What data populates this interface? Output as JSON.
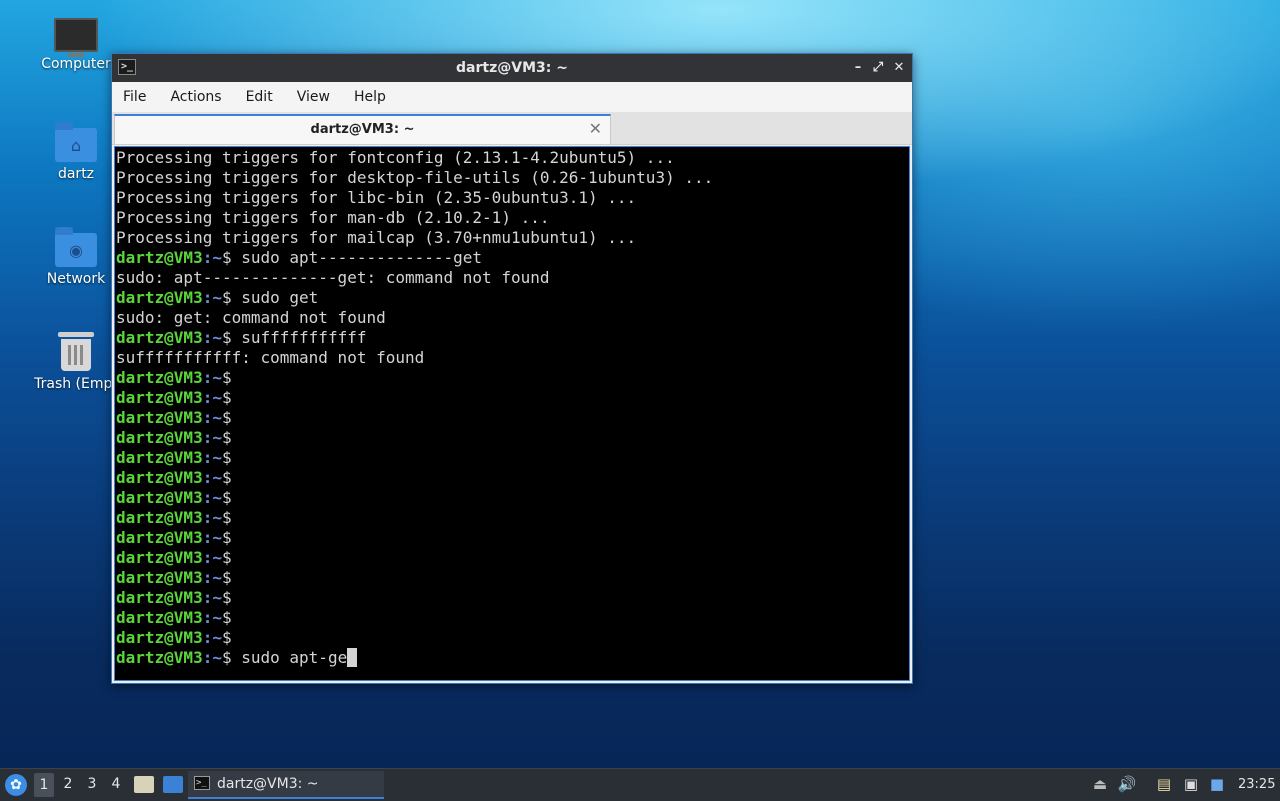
{
  "desktop": {
    "icons": [
      {
        "label": "Computer"
      },
      {
        "label": "dartz"
      },
      {
        "label": "Network"
      },
      {
        "label": "Trash (Empt"
      }
    ]
  },
  "window": {
    "title": "dartz@VM3: ~",
    "controls": {
      "minimize": "–",
      "maximize": "⤢",
      "close": "✕"
    },
    "menu": [
      "File",
      "Actions",
      "Edit",
      "View",
      "Help"
    ],
    "tab": {
      "title": "dartz@VM3: ~",
      "close": "✕"
    }
  },
  "terminal": {
    "prompt_user": "dartz@VM3",
    "prompt_path": ":~",
    "prompt_symbol": "$",
    "lines": [
      {
        "type": "out",
        "text": "Processing triggers for fontconfig (2.13.1-4.2ubuntu5) ..."
      },
      {
        "type": "out",
        "text": "Processing triggers for desktop-file-utils (0.26-1ubuntu3) ..."
      },
      {
        "type": "out",
        "text": "Processing triggers for libc-bin (2.35-0ubuntu3.1) ..."
      },
      {
        "type": "out",
        "text": "Processing triggers for man-db (2.10.2-1) ..."
      },
      {
        "type": "out",
        "text": "Processing triggers for mailcap (3.70+nmu1ubuntu1) ..."
      },
      {
        "type": "cmd",
        "text": " sudo apt--------------get"
      },
      {
        "type": "out",
        "text": "sudo: apt--------------get: command not found"
      },
      {
        "type": "cmd",
        "text": " sudo get"
      },
      {
        "type": "out",
        "text": "sudo: get: command not found"
      },
      {
        "type": "cmd",
        "text": " sufffffffffff"
      },
      {
        "type": "out",
        "text": "sufffffffffff: command not found"
      },
      {
        "type": "cmd",
        "text": ""
      },
      {
        "type": "cmd",
        "text": ""
      },
      {
        "type": "cmd",
        "text": ""
      },
      {
        "type": "cmd",
        "text": ""
      },
      {
        "type": "cmd",
        "text": ""
      },
      {
        "type": "cmd",
        "text": ""
      },
      {
        "type": "cmd",
        "text": ""
      },
      {
        "type": "cmd",
        "text": ""
      },
      {
        "type": "cmd",
        "text": ""
      },
      {
        "type": "cmd",
        "text": ""
      },
      {
        "type": "cmd",
        "text": ""
      },
      {
        "type": "cmd",
        "text": ""
      },
      {
        "type": "cmd",
        "text": ""
      },
      {
        "type": "cmd",
        "text": ""
      }
    ],
    "current_input": " sudo apt-ge"
  },
  "taskbar": {
    "workspaces": [
      "1",
      "2",
      "3",
      "4"
    ],
    "active_workspace": "1",
    "task_label": "dartz@VM3: ~",
    "clock": "23:25"
  },
  "colors": {
    "prompt_user": "#5ad53a",
    "prompt_path": "#6f8fd8",
    "accent": "#3b82d6",
    "titlebar": "#323337"
  }
}
